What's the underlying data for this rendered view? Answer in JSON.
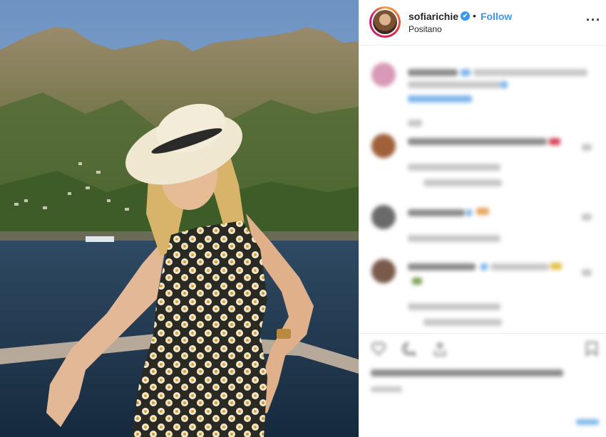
{
  "post": {
    "username": "sofiarichie",
    "verified_mark": "✔",
    "separator": "•",
    "follow_label": "Follow",
    "location": "Positano",
    "more_label": "···"
  },
  "icons": [
    "verified-badge-icon",
    "more-options-icon",
    "heart-icon",
    "comment-icon",
    "share-icon",
    "bookmark-icon"
  ],
  "colors": {
    "link_blue": "#3897f0",
    "text": "#262626",
    "border": "#efefef"
  }
}
